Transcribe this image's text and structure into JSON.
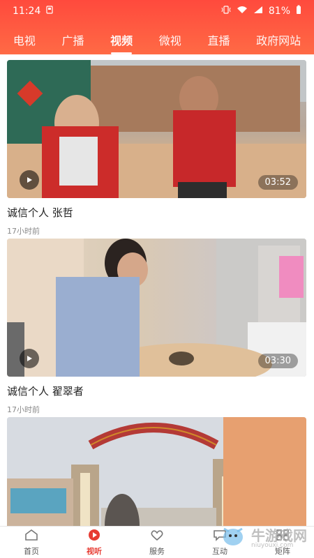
{
  "status": {
    "time": "11:24",
    "battery": "81%"
  },
  "tabs": [
    {
      "label": "电视"
    },
    {
      "label": "广播"
    },
    {
      "label": "视频",
      "active": true
    },
    {
      "label": "微视"
    },
    {
      "label": "直播"
    },
    {
      "label": "政府网站"
    }
  ],
  "videos": [
    {
      "title": "诚信个人 张哲",
      "time_ago": "17小时前",
      "duration": "03:52"
    },
    {
      "title": "诚信个人 翟翠者",
      "time_ago": "17小时前",
      "duration": "03:30"
    },
    {
      "title": "",
      "time_ago": "",
      "duration": ""
    }
  ],
  "bottom_nav": [
    {
      "label": "首页",
      "icon": "home-icon"
    },
    {
      "label": "视听",
      "icon": "play-circle-icon",
      "active": true
    },
    {
      "label": "服务",
      "icon": "heart-icon"
    },
    {
      "label": "互动",
      "icon": "chat-icon"
    },
    {
      "label": "矩阵",
      "icon": "grid-icon"
    }
  ],
  "watermark": {
    "brand": "牛游戏网",
    "url": "niuyouxi.com"
  }
}
